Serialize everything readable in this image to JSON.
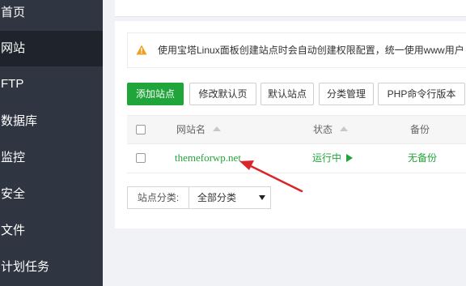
{
  "sidebar": {
    "items": [
      {
        "label": "首页"
      },
      {
        "label": "网站"
      },
      {
        "label": "FTP"
      },
      {
        "label": "数据库"
      },
      {
        "label": "监控"
      },
      {
        "label": "安全"
      },
      {
        "label": "文件"
      },
      {
        "label": "计划任务"
      }
    ],
    "active_index": 1
  },
  "notice": {
    "icon": "warning-icon",
    "text": "使用宝塔Linux面板创建站点时会自动创建权限配置，统一使用www用户"
  },
  "toolbar": {
    "add_site": "添加站点",
    "edit_default_page": "修改默认页",
    "default_site": "默认站点",
    "category_manage": "分类管理",
    "php_cli_version": "PHP命令行版本"
  },
  "table": {
    "headers": {
      "site_name": "网站名",
      "status": "状态",
      "backup": "备份"
    },
    "rows": [
      {
        "site_name": "themeforwp.net",
        "status": "运行中",
        "backup": "无备份"
      }
    ]
  },
  "filter": {
    "label": "站点分类:",
    "selected": "全部分类"
  },
  "colors": {
    "sidebar_bg": "#2f3641",
    "sidebar_active": "#1f242c",
    "accent_green": "#20a53a",
    "annotation_red": "#d9262b",
    "warning_orange": "#f0a020"
  }
}
